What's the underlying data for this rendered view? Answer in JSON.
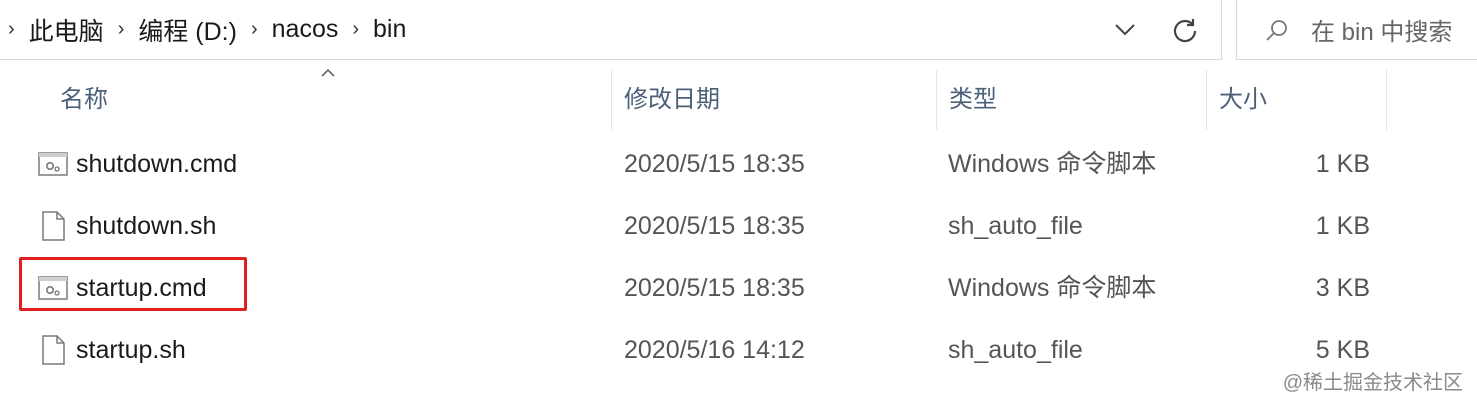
{
  "address_bar": {
    "breadcrumbs": [
      "此电脑",
      "编程 (D:)",
      "nacos",
      "bin"
    ]
  },
  "search": {
    "placeholder": "在 bin 中搜索"
  },
  "columns": {
    "name": "名称",
    "modified": "修改日期",
    "type": "类型",
    "size": "大小"
  },
  "files": [
    {
      "name": "shutdown.cmd",
      "modified": "2020/5/15 18:35",
      "type": "Windows 命令脚本",
      "size": "1 KB",
      "icon": "cmd-script-icon"
    },
    {
      "name": "shutdown.sh",
      "modified": "2020/5/15 18:35",
      "type": "sh_auto_file",
      "size": "1 KB",
      "icon": "blank-file-icon"
    },
    {
      "name": "startup.cmd",
      "modified": "2020/5/15 18:35",
      "type": "Windows 命令脚本",
      "size": "3 KB",
      "icon": "cmd-script-icon"
    },
    {
      "name": "startup.sh",
      "modified": "2020/5/16 14:12",
      "type": "sh_auto_file",
      "size": "5 KB",
      "icon": "blank-file-icon"
    }
  ],
  "highlight": {
    "target": "startup.cmd",
    "color": "#e02020"
  },
  "watermark": "@稀土掘金技术社区"
}
